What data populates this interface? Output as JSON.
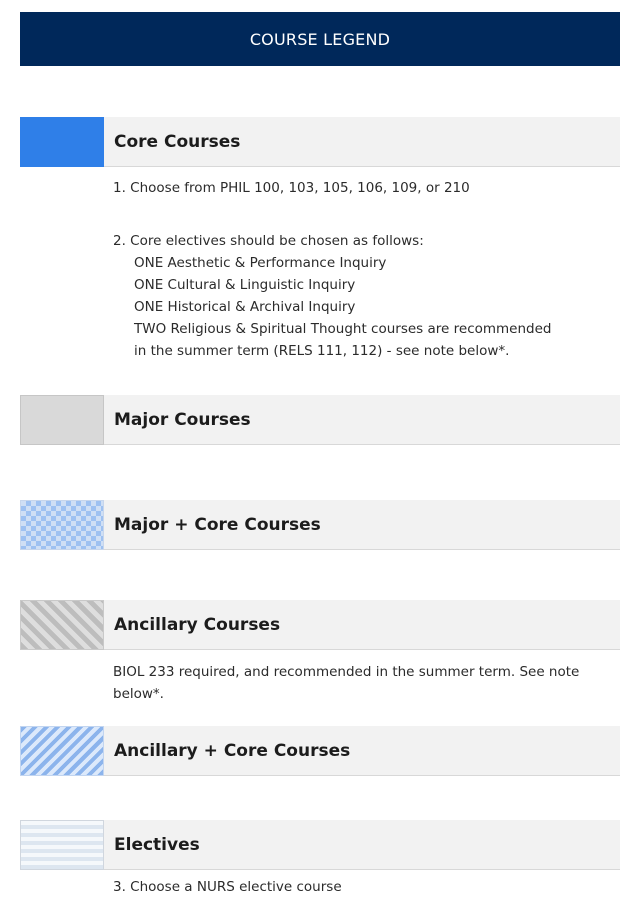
{
  "header": {
    "title": "COURSE LEGEND"
  },
  "legend": [
    {
      "label": "Core Courses"
    },
    {
      "label": "Major Courses"
    },
    {
      "label": "Major + Core Courses"
    },
    {
      "label": "Ancillary Courses"
    },
    {
      "label": "Ancillary + Core Courses"
    },
    {
      "label": "Electives"
    }
  ],
  "notes": {
    "core_1": "1. Choose from PHIL 100, 103, 105, 106, 109, or 210",
    "core_2_intro": "2. Core electives should be chosen as follows:",
    "core_2_items": [
      "ONE Aesthetic & Performance Inquiry",
      "ONE Cultural & Linguistic Inquiry",
      "ONE Historical & Archival Inquiry",
      "TWO Religious & Spiritual Thought courses are recommended"
    ],
    "core_2_tail": "in the summer term (RELS 111, 112) - see note below*.",
    "ancillary": "BIOL 233 required, and recommended in the summer term. See note below*.",
    "electives": "3. Choose a NURS elective course"
  }
}
